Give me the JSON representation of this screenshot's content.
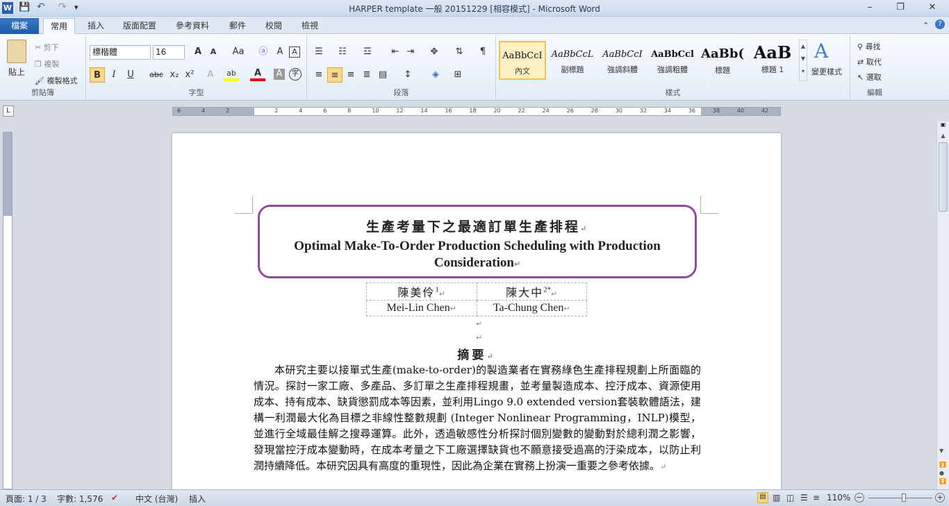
{
  "window": {
    "title": "HARPER template 一般 20151229 [相容模式] - Microsoft Word",
    "minimize": "–",
    "restore": "❐",
    "close": "✕"
  },
  "qat": {
    "app_icon": "W",
    "save": "💾",
    "undo": "↶",
    "redo": "↷",
    "more": "▾"
  },
  "tabs": {
    "file": "檔案",
    "home": "常用",
    "insert": "插入",
    "layout": "版面配置",
    "references": "參考資料",
    "mailings": "郵件",
    "review": "校閱",
    "view": "檢視"
  },
  "clipboard": {
    "paste": "貼上",
    "cut": "剪下",
    "copy": "複製",
    "format_painter": "複製格式",
    "label": "剪貼簿"
  },
  "font": {
    "name": "標楷體",
    "size": "16",
    "label": "字型",
    "grow": "A",
    "shrink": "A",
    "case": "Aa",
    "clear": "A",
    "bold": "B",
    "italic": "I",
    "underline": "U",
    "strike": "abc",
    "sub": "x₂",
    "sup": "x²",
    "effects": "A",
    "highlight": "ab",
    "color": "A",
    "char_shade": "A",
    "enclose": "字"
  },
  "paragraph": {
    "label": "段落"
  },
  "styles": {
    "label": "樣式",
    "items": [
      {
        "sample": "AaBbCcI",
        "name": "內文"
      },
      {
        "sample": "AaBbCcL",
        "name": "副標題"
      },
      {
        "sample": "AaBbCcI",
        "name": "強調斜體"
      },
      {
        "sample": "AaBbCcl",
        "name": "強調粗體"
      },
      {
        "sample": "AaBb(",
        "name": "標題"
      },
      {
        "sample": "AaB",
        "name": "標題 1"
      }
    ],
    "change_styles": "變更樣式"
  },
  "editing": {
    "find": "尋找",
    "replace": "取代",
    "select": "選取",
    "label": "編輯"
  },
  "ruler": {
    "ticks": [
      "6",
      "4",
      "2",
      "",
      "2",
      "4",
      "6",
      "8",
      "10",
      "12",
      "14",
      "16",
      "18",
      "20",
      "22",
      "24",
      "26",
      "28",
      "30",
      "32",
      "34",
      "36",
      "38",
      "40",
      "42"
    ]
  },
  "document": {
    "title_cn": "生產考量下之最適訂單生產排程",
    "title_en": "Optimal Make-To-Order Production Scheduling with Production Consideration",
    "authors": [
      {
        "name": "陳美伶",
        "sup": "1"
      },
      {
        "name": "陳大中",
        "sup": "2*"
      }
    ],
    "authors_en": [
      "Mei-Lin Chen",
      "Ta-Chung Chen"
    ],
    "abstract_title": "摘要",
    "abstract": "本研究主要以接單式生產(make-to-order)的製造業者在實務綠色生產排程規劃上所面臨的情況。探討一家工廠、多產品、多訂單之生產排程規畫，並考量製造成本、控汙成本、資源使用成本、持有成本、缺貨懲罰成本等因素，並利用Lingo 9.0 extended version套裝軟體語法，建構一利潤最大化為目標之非線性整數規劃 (Integer Nonlinear Programming，INLP)模型，並進行全域最佳解之搜尋運算。此外，透過敏感性分析探討個別變數的變動對於總利潤之影響，發現當控汙成本變動時，在成本考量之下工廠選擇缺貨也不願意接受過高的汙染成本，以防止利潤持續降低。本研究因具有高度的重現性，因此為企業在實務上扮演一重要之參考依據。",
    "para_mark": "↵"
  },
  "status": {
    "page": "頁面: 1 / 3",
    "words": "字數: 1,576",
    "lang": "中文 (台灣)",
    "mode": "插入",
    "zoom": "110%",
    "zoom_level": 0.55
  }
}
